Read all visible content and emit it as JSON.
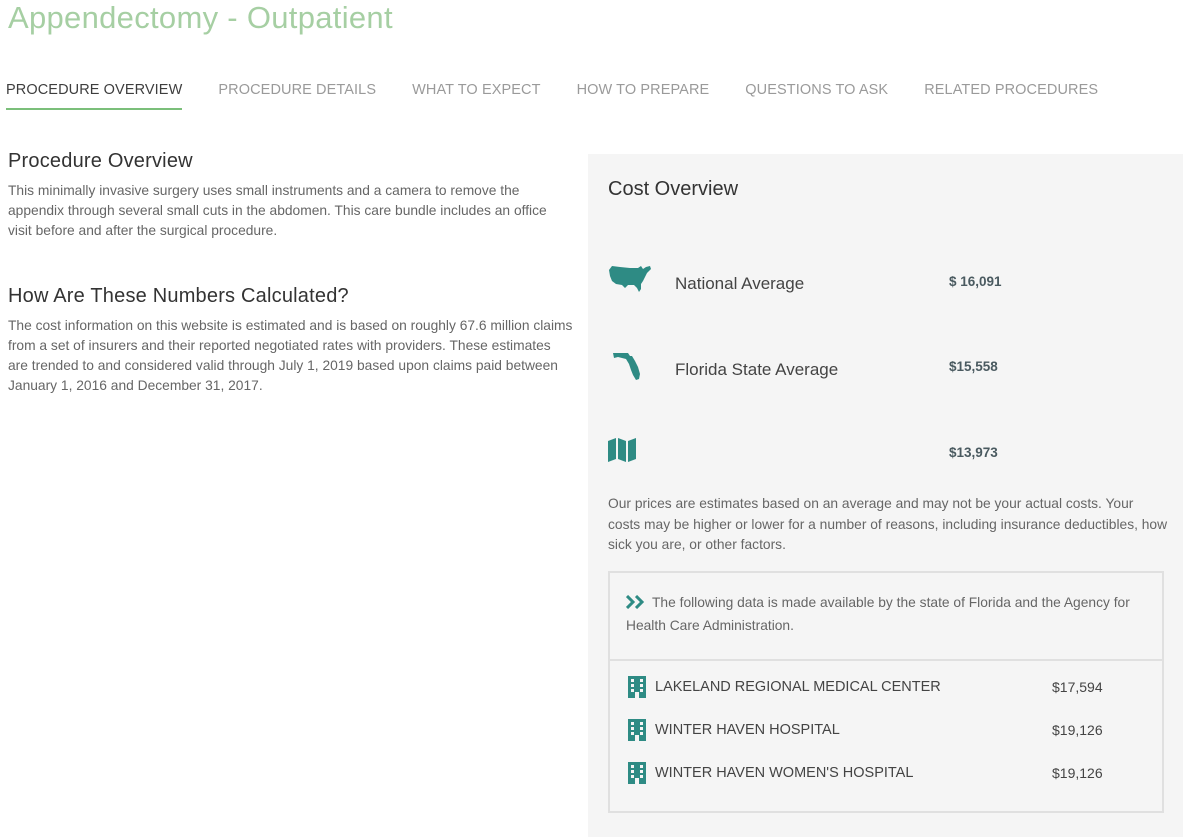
{
  "page_title": "Appendectomy - Outpatient",
  "tabs": [
    {
      "label": "PROCEDURE OVERVIEW",
      "active": true
    },
    {
      "label": "PROCEDURE DETAILS"
    },
    {
      "label": "WHAT TO EXPECT"
    },
    {
      "label": "HOW TO PREPARE"
    },
    {
      "label": "QUESTIONS TO ASK"
    },
    {
      "label": "RELATED PROCEDURES"
    }
  ],
  "overview": {
    "heading": "Procedure Overview",
    "text": "This minimally invasive surgery uses small instruments and a camera to remove the appendix through several small cuts in the abdomen. This care bundle includes an office visit before and after the surgical procedure."
  },
  "calculation": {
    "heading": "How Are These Numbers Calculated?",
    "text": "The cost information on this website is estimated and is based on roughly 67.6 million claims from a set of insurers and their reported negotiated rates with providers. These estimates are trended to and considered valid through July 1, 2019 based upon claims paid between January 1, 2016 and December 31, 2017."
  },
  "cost": {
    "title": "Cost Overview",
    "rows": [
      {
        "icon": "usa-map-icon",
        "label": "National Average",
        "value": "$ 16,091"
      },
      {
        "icon": "florida-map-icon",
        "label": "Florida State Average",
        "value": "$15,558"
      },
      {
        "icon": "folded-map-icon",
        "label": "",
        "value": "$13,973"
      }
    ],
    "disclaimer": "Our prices are estimates based on an average and may not be your actual costs. Your costs may be higher or lower for a number of reasons, including insurance deductibles, how sick you are, or other factors."
  },
  "florida_data": {
    "note": "The following data is made available by the state of Florida and the Agency for Health Care Administration.",
    "hospitals": [
      {
        "name": "LAKELAND REGIONAL MEDICAL CENTER",
        "price": "$17,594"
      },
      {
        "name": "WINTER HAVEN HOSPITAL",
        "price": "$19,126"
      },
      {
        "name": "WINTER HAVEN WOMEN'S HOSPITAL",
        "price": "$19,126"
      }
    ]
  },
  "colors": {
    "title": "#a6cfa3",
    "accent": "#2e8b84",
    "tab_underline": "#7bbf7a",
    "panel_bg": "#f5f5f5"
  }
}
